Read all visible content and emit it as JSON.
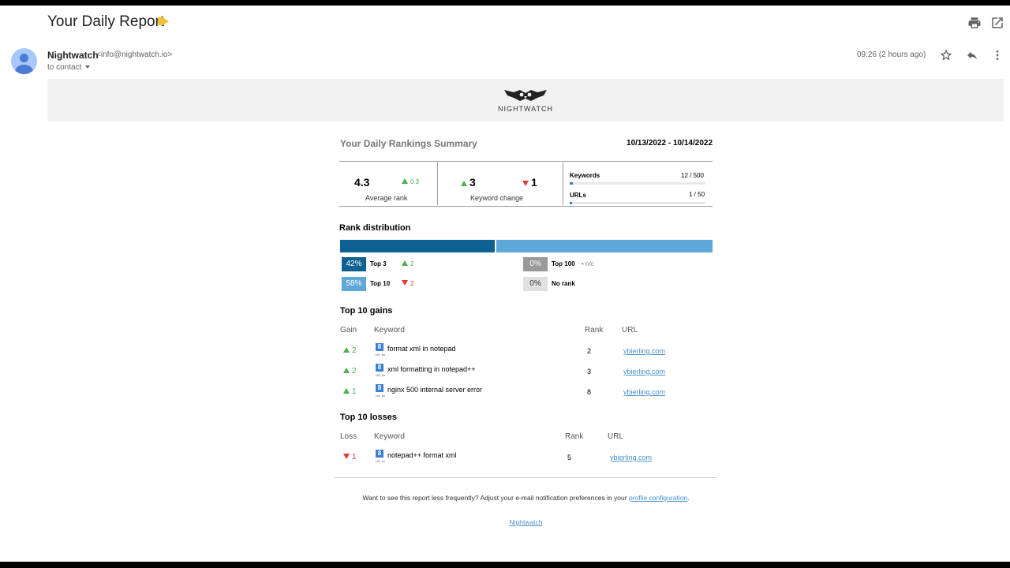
{
  "email": {
    "subject": "Your Daily Report",
    "sender_name": "Nightwatch",
    "sender_email": "<info@nightwatch.io>",
    "to_line": "to contact",
    "datetime": "09:26 (2 hours ago)"
  },
  "banner": {
    "logo_text": "NIGHTWATCH"
  },
  "summary": {
    "title": "Your Daily Rankings Summary",
    "date_range": "10/13/2022 - 10/14/2022",
    "avg_rank": {
      "value": "4.3",
      "change": "0.3",
      "caption": "Average rank"
    },
    "keyword_change": {
      "up": "3",
      "down": "1",
      "caption": "Keyword change"
    },
    "keywords": {
      "label": "Keywords",
      "value": "12 / 500",
      "fill": 0.024
    },
    "urls": {
      "label": "URLs",
      "value": "1 / 50",
      "fill": 0.02
    }
  },
  "distribution": {
    "title": "Rank distribution",
    "bar": {
      "top3": 0.42,
      "top10": 0.58
    },
    "colors": {
      "top3": "#0e6291",
      "top10": "#5ea7d9",
      "top100": "#999999",
      "norank": "#e0e0e0"
    },
    "items": [
      {
        "pct": "42%",
        "label": "Top 3",
        "change": "2",
        "dir": "up"
      },
      {
        "pct": "58%",
        "label": "Top 10",
        "change": "2",
        "dir": "down"
      },
      {
        "pct": "0%",
        "label": "Top 100",
        "change": "n/c",
        "dir": "none"
      },
      {
        "pct": "0%",
        "label": "No rank",
        "change": "",
        "dir": "none"
      }
    ]
  },
  "gains": {
    "title": "Top 10 gains",
    "headers": {
      "gain": "Gain",
      "keyword": "Keyword",
      "rank": "Rank",
      "url": "URL"
    },
    "rows": [
      {
        "change": "2",
        "keyword": "format xml in notepad",
        "locale": "US, en",
        "rank": "2",
        "url": "ybierling.com"
      },
      {
        "change": "2",
        "keyword": "xml formatting in notepad++",
        "locale": "US, en",
        "rank": "3",
        "url": "ybierling.com"
      },
      {
        "change": "1",
        "keyword": "nginx 500 internal server error",
        "locale": "US, en",
        "rank": "8",
        "url": "ybierling.com"
      }
    ]
  },
  "losses": {
    "title": "Top 10 losses",
    "headers": {
      "loss": "Loss",
      "keyword": "Keyword",
      "rank": "Rank",
      "url": "URL"
    },
    "rows": [
      {
        "change": "1",
        "keyword": "notepad++ format xml",
        "locale": "US, en",
        "rank": "5",
        "url": "ybierling.com"
      }
    ]
  },
  "footer": {
    "text": "Want to see this report less frequently? Adjust your e-mail notification preferences in your ",
    "link1": "profile configuration",
    "period": ".",
    "link2": "Nightwatch"
  },
  "icons": [
    "print-icon",
    "open-in-new-icon",
    "star-icon",
    "reply-icon",
    "more-vert-icon",
    "google-icon"
  ]
}
